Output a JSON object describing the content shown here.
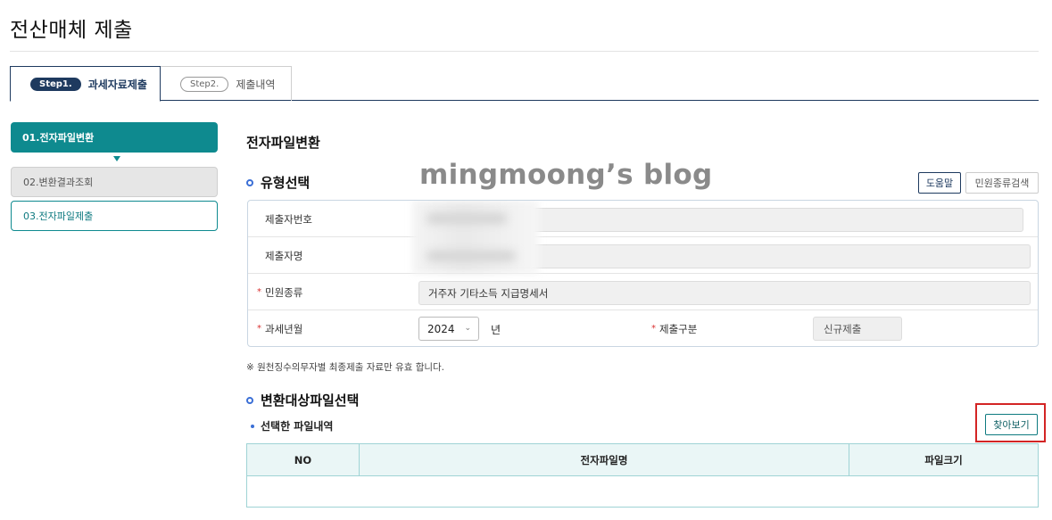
{
  "page_title": "전산매체 제출",
  "tabs": [
    {
      "step": "Step1.",
      "label": "과세자료제출",
      "active": true
    },
    {
      "step": "Step2.",
      "label": "제출내역",
      "active": false
    }
  ],
  "side_nav": [
    {
      "label": "01.전자파일변환"
    },
    {
      "label": "02.변환결과조회"
    },
    {
      "label": "03.전자파일제출"
    }
  ],
  "watermark": "mingmoong’s blog",
  "main": {
    "section_title": "전자파일변환",
    "type_select_heading": "유형선택",
    "help_button": "도움말",
    "petition_search_button": "민원종류검색",
    "form": {
      "submitter_no_label": "제출자번호",
      "submitter_name_label": "제출자명",
      "petition_type_label": "민원종류",
      "petition_type_value": "거주자 기타소득 지급명세서",
      "tax_year_label": "과세년월",
      "tax_year_value": "2024",
      "year_unit": "년",
      "submit_type_label": "제출구분",
      "submit_type_value": "신규제출"
    },
    "notice": "※ 원천징수의무자별 최종제출 자료만 유효 합니다.",
    "convert_file_heading": "변환대상파일선택",
    "selected_files_label": "선택한 파일내역",
    "browse_button": "찾아보기",
    "table_headers": [
      "NO",
      "전자파일명",
      "파일크기"
    ]
  },
  "colors": {
    "navy": "#1e3a5f",
    "teal": "#0e8a8f",
    "highlight_red": "#d32424",
    "ring_blue": "#3b6fd6"
  }
}
